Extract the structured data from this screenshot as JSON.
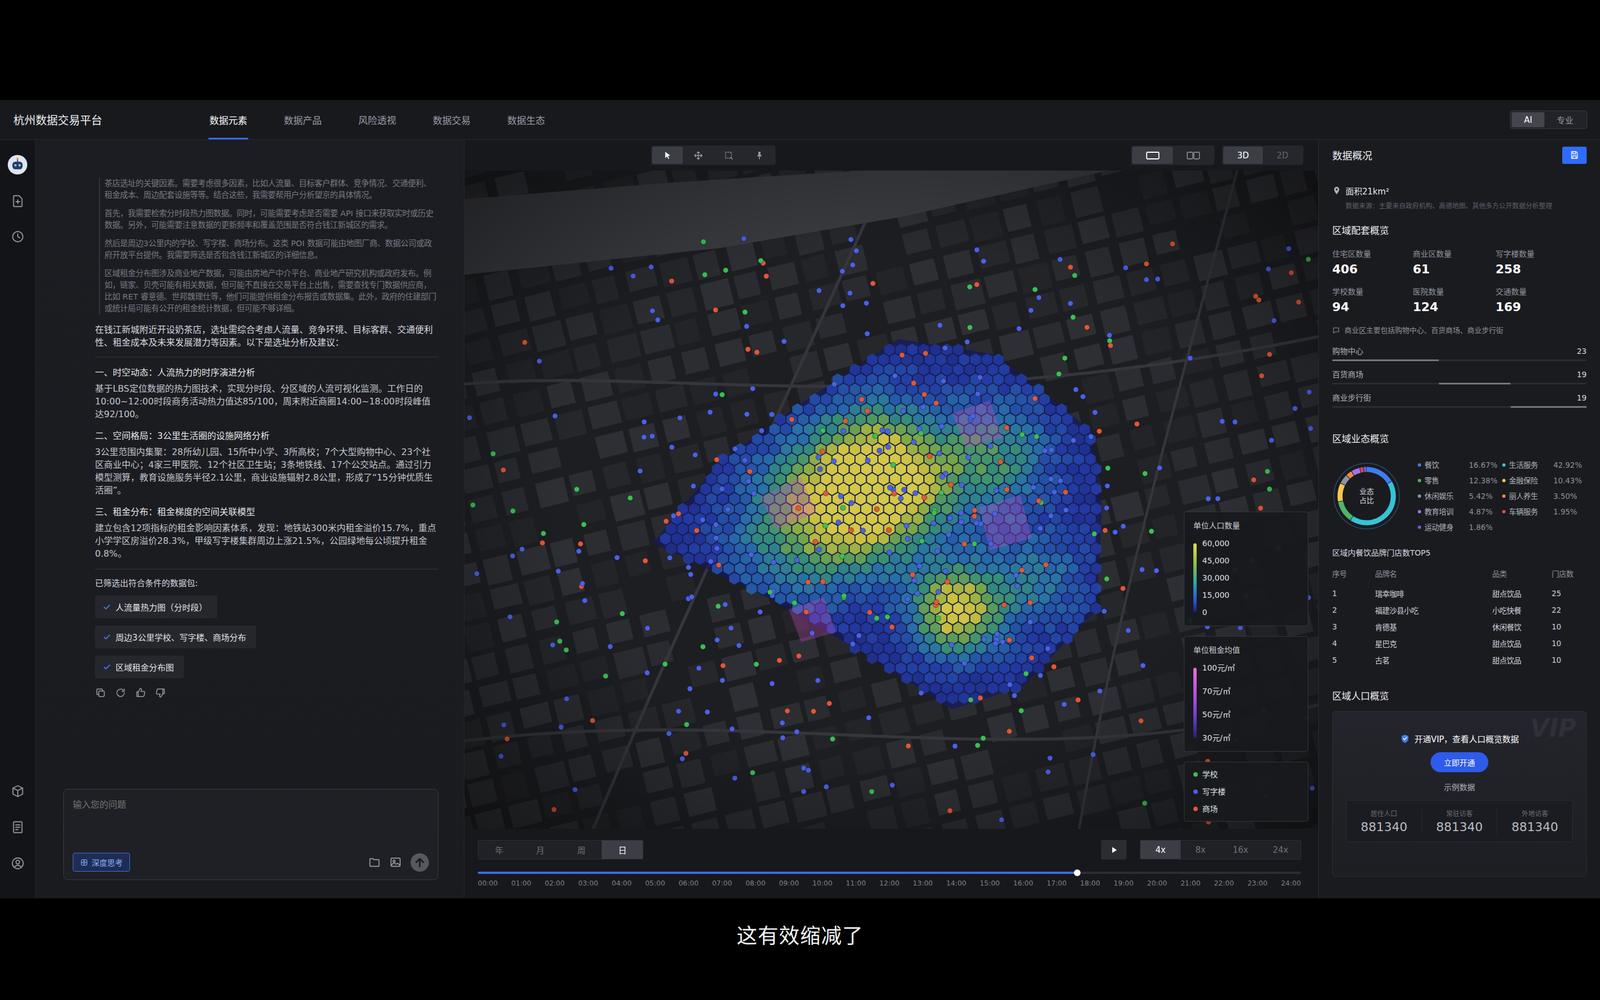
{
  "nav": {
    "title": "杭州数据交易平台",
    "tabs": [
      {
        "label": "数据元素",
        "selected": true
      },
      {
        "label": "数据产品",
        "selected": false
      },
      {
        "label": "风险透视",
        "selected": false
      },
      {
        "label": "数据交易",
        "selected": false
      },
      {
        "label": "数据生态",
        "selected": false
      }
    ],
    "modes": [
      {
        "label": "AI",
        "selected": true
      },
      {
        "label": "专业",
        "selected": false
      }
    ]
  },
  "chat": {
    "thinking": [
      "茶店选址的关键因素。需要考虑很多因素，比如人流量、目标客户群体、竞争情况、交通便利、租金成本、周边配套设施等等。结合这些，我需要帮用户分析望京的具体情况。",
      "首先，我需要检索分时段热力图数据。同时，可能需要考虑是否需要 API 接口来获取实时或历史数据。另外，可能需要注意数据的更新频率和覆盖范围是否符合钱江新城区的需求。",
      "然后是周边3公里内的学校、写字楼、商场分布。这类 POI 数据可能由地图厂商、数据公司或政府开放平台提供。我需要筛选是否包含钱江新城区的详细信息。",
      "区域租金分布图涉及商业地产数据，可能由房地产中介平台、商业地产研究机构或政府发布。例如，链家、贝壳可能有相关数据，但可能不直接在交易平台上出售，需要查找专门数据供应商，比如 RET 睿意德、世邦魏理仕等，他们可能提供租金分布报告或数据集。此外，政府的住建部门或统计局可能有公开的租金统计数据，但可能不够详细。"
    ],
    "intro": "在钱江新城附近开设奶茶店，选址需综合考虑人流量、竞争环境、目标客群、交通便利性、租金成本及未来发展潜力等因素。以下是选址分析及建议：",
    "sections": [
      {
        "title": "一、时空动态：人流热力的时序演进分析",
        "body": "基于LBS定位数据的热力图技术，实现分时段、分区域的人流可视化监测。工作日的10:00~12:00时段商务活动热力值达85/100，周末附近商圈14:00~18:00时段峰值达92/100。"
      },
      {
        "title": "二、空间格局：3公里生活圈的设施网络分析",
        "body": "3公里范围内集聚：28所幼儿园、15所中小学、3所高校；7个大型购物中心、23个社区商业中心；4家三甲医院、12个社区卫生站；3条地铁线、17个公交站点。通过引力模型测算，教育设施服务半径2.1公里，商业设施辐射2.8公里，形成了“15分钟优质生活圈”。"
      },
      {
        "title": "三、租金分布：租金梯度的空间关联模型",
        "body": "建立包含12项指标的租金影响因素体系，发现：地铁站300米内租金溢价15.7%，重点小学学区房溢价28.3%，甲级写字楼集群周边上涨21.5%，公园绿地每公顷提升租金0.8%。"
      }
    ],
    "packages_label": "已筛选出符合条件的数据包:",
    "packages": [
      {
        "label": "人流量热力图（分时段）",
        "checked": true
      },
      {
        "label": "周边3公里学校、写字楼、商场分布",
        "checked": true
      },
      {
        "label": "区域租金分布图",
        "checked": true
      }
    ],
    "input": {
      "placeholder": "输入您的问题",
      "deep_think": {
        "label": "深度思考",
        "selected": true
      }
    }
  },
  "map": {
    "tools": [
      {
        "kind": "pointer",
        "selected": true
      },
      {
        "kind": "move",
        "selected": false
      },
      {
        "kind": "box",
        "selected": false
      },
      {
        "kind": "pin",
        "selected": false
      }
    ],
    "layouts": [
      {
        "kind": "single",
        "selected": true
      },
      {
        "kind": "split",
        "selected": false
      }
    ],
    "views": [
      {
        "label": "3D",
        "selected": true
      },
      {
        "label": "2D",
        "selected": false
      }
    ],
    "population_legend": {
      "title": "单位人口数量",
      "ticks": [
        "60,000",
        "45,000",
        "30,000",
        "15,000",
        "0"
      ]
    },
    "rent_legend": {
      "title": "单位租金均值",
      "ticks": [
        "100元/㎡",
        "70元/㎡",
        "50元/㎡",
        "30元/㎡"
      ]
    },
    "poi_legend": [
      {
        "label": "学校",
        "color": "#3cbf55"
      },
      {
        "label": "写字楼",
        "color": "#4a62e6"
      },
      {
        "label": "商场",
        "color": "#e0583a"
      }
    ],
    "timeline": {
      "periods": [
        {
          "label": "年",
          "selected": false
        },
        {
          "label": "月",
          "selected": false
        },
        {
          "label": "周",
          "selected": false
        },
        {
          "label": "日",
          "selected": true
        }
      ],
      "playing": false,
      "speeds": [
        {
          "label": "4x",
          "selected": true
        },
        {
          "label": "8x",
          "selected": false
        },
        {
          "label": "16x",
          "selected": false
        },
        {
          "label": "24x",
          "selected": false
        }
      ],
      "level": 0.728,
      "ticks": [
        "00:00",
        "01:00",
        "02:00",
        "03:00",
        "04:00",
        "05:00",
        "06:00",
        "07:00",
        "08:00",
        "09:00",
        "10:00",
        "11:00",
        "12:00",
        "13:00",
        "14:00",
        "15:00",
        "16:00",
        "17:00",
        "18:00",
        "19:00",
        "20:00",
        "21:00",
        "22:00",
        "23:00",
        "24:00"
      ]
    }
  },
  "overview": {
    "title": "数据概况",
    "area": "面积21km²",
    "source": "数据来源：主要来自政府机构、高德地图、其他多方公开数据分析整理",
    "facilities": {
      "title": "区域配套概览",
      "stats": [
        {
          "label": "住宅区数量",
          "value": "406"
        },
        {
          "label": "商业区数量",
          "value": "61"
        },
        {
          "label": "写字楼数量",
          "value": "258"
        },
        {
          "label": "学校数量",
          "value": "94"
        },
        {
          "label": "医院数量",
          "value": "124"
        },
        {
          "label": "交通数量",
          "value": "169"
        }
      ],
      "note": "商业区主要包括购物中心、百货商场、商业步行街",
      "bars": [
        {
          "label": "购物中心",
          "value": "23",
          "level": 0.42
        },
        {
          "label": "百货商场",
          "value": "19",
          "level": 0.28
        },
        {
          "label": "商业步行街",
          "value": "19",
          "level": 0.3
        }
      ]
    },
    "business": {
      "title": "区域业态概览",
      "center": "业态占比",
      "items": [
        {
          "label": "餐饮",
          "share": "16.67%",
          "value": 16.67,
          "color": "#3f7cf2"
        },
        {
          "label": "生活服务",
          "share": "42.92%",
          "value": 42.92,
          "color": "#36c3d6"
        },
        {
          "label": "零售",
          "share": "12.38%",
          "value": 12.38,
          "color": "#4fb56a"
        },
        {
          "label": "金融保险",
          "share": "10.43%",
          "value": 10.43,
          "color": "#f2c94c"
        },
        {
          "label": "休闲娱乐",
          "share": "5.42%",
          "value": 5.42,
          "color": "#8a93a6"
        },
        {
          "label": "丽人养生",
          "share": "3.50%",
          "value": 3.5,
          "color": "#f08a3c"
        },
        {
          "label": "教育培训",
          "share": "4.87%",
          "value": 4.87,
          "color": "#a46ff0"
        },
        {
          "label": "车辆服务",
          "share": "1.95%",
          "value": 1.95,
          "color": "#e5484d"
        },
        {
          "label": "运动健身",
          "share": "1.86%",
          "value": 1.86,
          "color": "#6b5cf0"
        }
      ]
    },
    "top5": {
      "title": "区域内餐饮品牌门店数TOP5",
      "columns": [
        "序号",
        "品牌名",
        "品类",
        "门店数"
      ],
      "rows": [
        [
          "1",
          "瑞幸咖啡",
          "甜点饮品",
          "25"
        ],
        [
          "2",
          "福建沙县小吃",
          "小吃快餐",
          "22"
        ],
        [
          "3",
          "肯德基",
          "休闲餐饮",
          "10"
        ],
        [
          "4",
          "星巴克",
          "甜点饮品",
          "10"
        ],
        [
          "5",
          "古茗",
          "甜点饮品",
          "10"
        ]
      ]
    },
    "population": {
      "title": "区域人口概览",
      "watermark": "VIP",
      "vip_text": "开通VIP，查看人口概览数据",
      "button": "立即开通",
      "sample_label": "示例数据",
      "stats": [
        {
          "label": "居住人口",
          "value": "881340"
        },
        {
          "label": "常驻访客",
          "value": "881340"
        },
        {
          "label": "外地访客",
          "value": "881340"
        }
      ]
    }
  },
  "subtitle": "这有效缩减了"
}
